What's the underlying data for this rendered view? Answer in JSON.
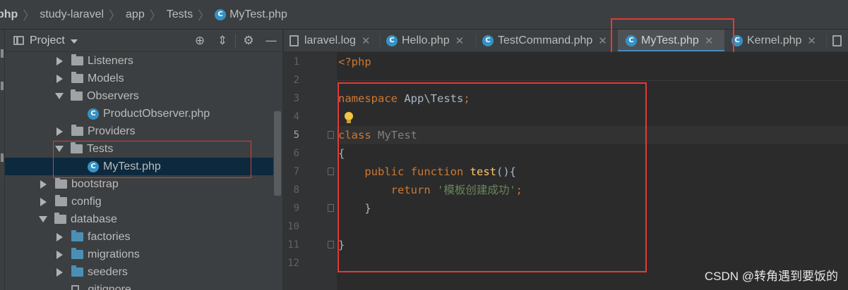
{
  "breadcrumb": {
    "items": [
      "php",
      "study-laravel",
      "app",
      "Tests",
      "MyTest.php"
    ],
    "file_icon": "class-icon"
  },
  "project_panel": {
    "title": "Project",
    "tools": [
      "locate-icon",
      "collapse-icon",
      "gear-icon",
      "minimize-icon"
    ]
  },
  "tree": {
    "rows": [
      {
        "label": "Listeners",
        "type": "folder",
        "state": "collapsed"
      },
      {
        "label": "Models",
        "type": "folder",
        "state": "collapsed"
      },
      {
        "label": "Observers",
        "type": "folder",
        "state": "expanded"
      },
      {
        "label": "ProductObserver.php",
        "type": "class-file"
      },
      {
        "label": "Providers",
        "type": "folder",
        "state": "collapsed"
      },
      {
        "label": "Tests",
        "type": "folder",
        "state": "expanded"
      },
      {
        "label": "MyTest.php",
        "type": "class-file",
        "selected": true
      },
      {
        "label": "bootstrap",
        "type": "folder",
        "state": "collapsed"
      },
      {
        "label": "config",
        "type": "folder",
        "state": "collapsed"
      },
      {
        "label": "database",
        "type": "folder",
        "state": "expanded"
      },
      {
        "label": "factories",
        "type": "folder-blue",
        "state": "collapsed"
      },
      {
        "label": "migrations",
        "type": "folder-blue",
        "state": "collapsed"
      },
      {
        "label": "seeders",
        "type": "folder-blue",
        "state": "collapsed"
      },
      {
        "label": ".gitignore",
        "type": "file"
      }
    ]
  },
  "tabs": [
    {
      "label": "laravel.log",
      "icon": "log-file-icon",
      "active": false
    },
    {
      "label": "Hello.php",
      "icon": "class-icon",
      "active": false
    },
    {
      "label": "TestCommand.php",
      "icon": "class-icon",
      "active": false
    },
    {
      "label": "MyTest.php",
      "icon": "class-icon",
      "active": true
    },
    {
      "label": "Kernel.php",
      "icon": "class-icon",
      "active": false
    }
  ],
  "editor": {
    "line_numbers": [
      "1",
      "2",
      "3",
      "4",
      "5",
      "6",
      "7",
      "8",
      "9",
      "10",
      "11",
      "12"
    ],
    "current_line": 5,
    "code": {
      "open_tag": "<?php",
      "namespace_kw": "namespace",
      "namespace_name": "App\\Tests",
      "semicolon": ";",
      "class_kw": "class",
      "class_name": "MyTest",
      "open_brace": "{",
      "public_kw": "public",
      "function_kw": "function",
      "method_name": "test",
      "method_sig": "(){",
      "return_kw": "return",
      "return_string": "'模板创建成功'",
      "inner_close": "}",
      "outer_close": "}"
    }
  },
  "watermark": "CSDN @转角遇到要饭的",
  "colors": {
    "highlight_box": "#e53935",
    "active_tab_underline": "#4a88c7",
    "class_icon": "#3592c4"
  }
}
